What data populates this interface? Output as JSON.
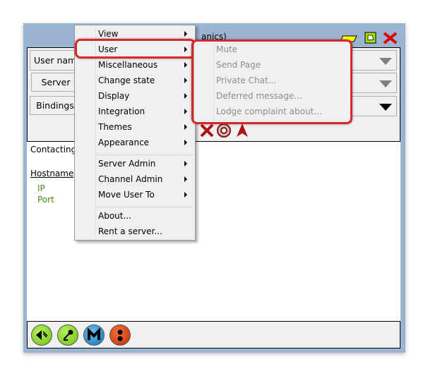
{
  "window": {
    "title_visible": "anics)",
    "accent_frame": "#9bb4d1"
  },
  "fields": [
    {
      "label": "User nam"
    },
    {
      "label": "Server"
    },
    {
      "label": "Bindings"
    }
  ],
  "log": {
    "line1": "Contacting",
    "hostname": "Hostname",
    "ip": "IP",
    "port": "Port"
  },
  "menu": {
    "items": [
      "View",
      "User",
      "Miscellaneous",
      "Change state",
      "Display",
      "Integration",
      "Themes",
      "Appearance",
      "Server Admin",
      "Channel Admin",
      "Move User To",
      "About...",
      "Rent a server..."
    ],
    "highlighted": "User"
  },
  "submenu": {
    "items": [
      "Mute",
      "Send Page",
      "Private Chat...",
      "Deferred message...",
      "Lodge complaint about..."
    ],
    "disabled": true
  },
  "highlight_color": "#d9262a"
}
